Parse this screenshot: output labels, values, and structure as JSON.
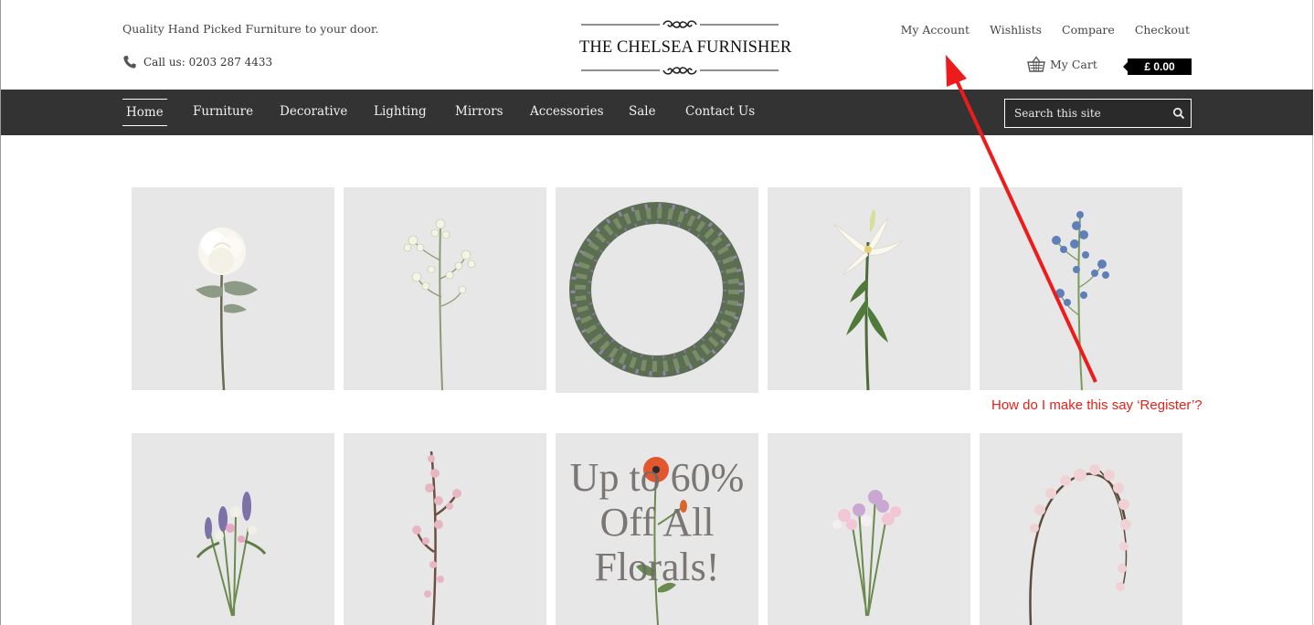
{
  "header": {
    "tagline": "Quality Hand Picked Furniture to your door.",
    "phone": "Call us: 0203 287 4433",
    "logo_text": "THE CHELSEA FURNISHER",
    "top_links": [
      "My Account",
      "Wishlists",
      "Compare",
      "Checkout"
    ],
    "cart_label": "My Cart",
    "cart_total": "£ 0.00"
  },
  "nav": {
    "items": [
      "Home",
      "Furniture",
      "Decorative",
      "Lighting",
      "Mirrors",
      "Accessories",
      "Sale",
      "Contact Us"
    ],
    "active": "Home"
  },
  "search": {
    "placeholder": "Search this site"
  },
  "promo": {
    "text": "Up to 60% Off All Florals!"
  },
  "annotation": {
    "text": "How do I make this say ‘Register’?",
    "color": "#e8201a"
  },
  "colors": {
    "navbar": "#333333",
    "tile_bg": "#e8e7e7",
    "annotation": "#e8201a"
  },
  "products": [
    {
      "icon": "white-rose-icon"
    },
    {
      "icon": "white-blossom-stem-icon"
    },
    {
      "icon": "lavender-wreath-icon"
    },
    {
      "icon": "white-lily-icon"
    },
    {
      "icon": "blue-delphinium-icon"
    },
    {
      "icon": "wildflower-bouquet-icon"
    },
    {
      "icon": "pink-blossom-branch-icon"
    },
    {
      "icon": "red-poppy-icon"
    },
    {
      "icon": "sweet-pea-bunch-icon"
    },
    {
      "icon": "blossom-arch-icon"
    }
  ]
}
